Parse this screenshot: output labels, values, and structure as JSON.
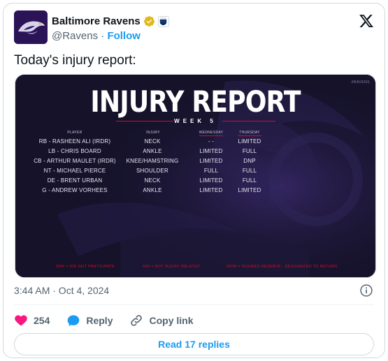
{
  "author": {
    "name": "Baltimore Ravens",
    "handle": "@Ravens",
    "separator": "·",
    "follow_label": "Follow"
  },
  "tweet": {
    "text": "Today's injury report:",
    "timestamp": "3:44 AM · Oct 4, 2024"
  },
  "media": {
    "title": "INJURY REPORT",
    "subtitle": "WEEK 5",
    "brand_tag": "#RAVENS",
    "columns": [
      "PLAYER",
      "INJURY",
      "WEDNESDAY",
      "THURSDAY"
    ],
    "rows": [
      {
        "player": "RB - RASHEEN ALI (IRDR)",
        "injury": "NECK",
        "wednesday": "- -",
        "thursday": "LIMITED"
      },
      {
        "player": "LB - CHRIS BOARD",
        "injury": "ANKLE",
        "wednesday": "LIMITED",
        "thursday": "FULL"
      },
      {
        "player": "CB - ARTHUR MAULET (IRDR)",
        "injury": "KNEE/HAMSTRING",
        "wednesday": "LIMITED",
        "thursday": "DNP"
      },
      {
        "player": "NT - MICHAEL PIERCE",
        "injury": "SHOULDER",
        "wednesday": "FULL",
        "thursday": "FULL"
      },
      {
        "player": "DE - BRENT URBAN",
        "injury": "NECK",
        "wednesday": "LIMITED",
        "thursday": "FULL"
      },
      {
        "player": "G - ANDREW VORHEES",
        "injury": "ANKLE",
        "wednesday": "LIMITED",
        "thursday": "LIMITED"
      }
    ],
    "footnotes": [
      "DNP = DID NOT PARTICIPATE",
      "NIR = NOT INJURY RELATED",
      "IRDR = INJURED RESERVE - DESIGNATED TO RETURN"
    ]
  },
  "actions": {
    "like_count": "254",
    "reply_label": "Reply",
    "copy_link_label": "Copy link"
  },
  "read_replies_label": "Read 17 replies",
  "colors": {
    "accent": "#1d9bf0",
    "like": "#f91880",
    "ravens_purple": "#241773",
    "report_red": "#c8102e",
    "verified_gold": "#e2b719"
  },
  "icons": [
    "x-logo-icon",
    "verified-badge-icon",
    "nfl-badge-icon",
    "info-icon",
    "heart-icon",
    "reply-icon",
    "link-icon"
  ]
}
